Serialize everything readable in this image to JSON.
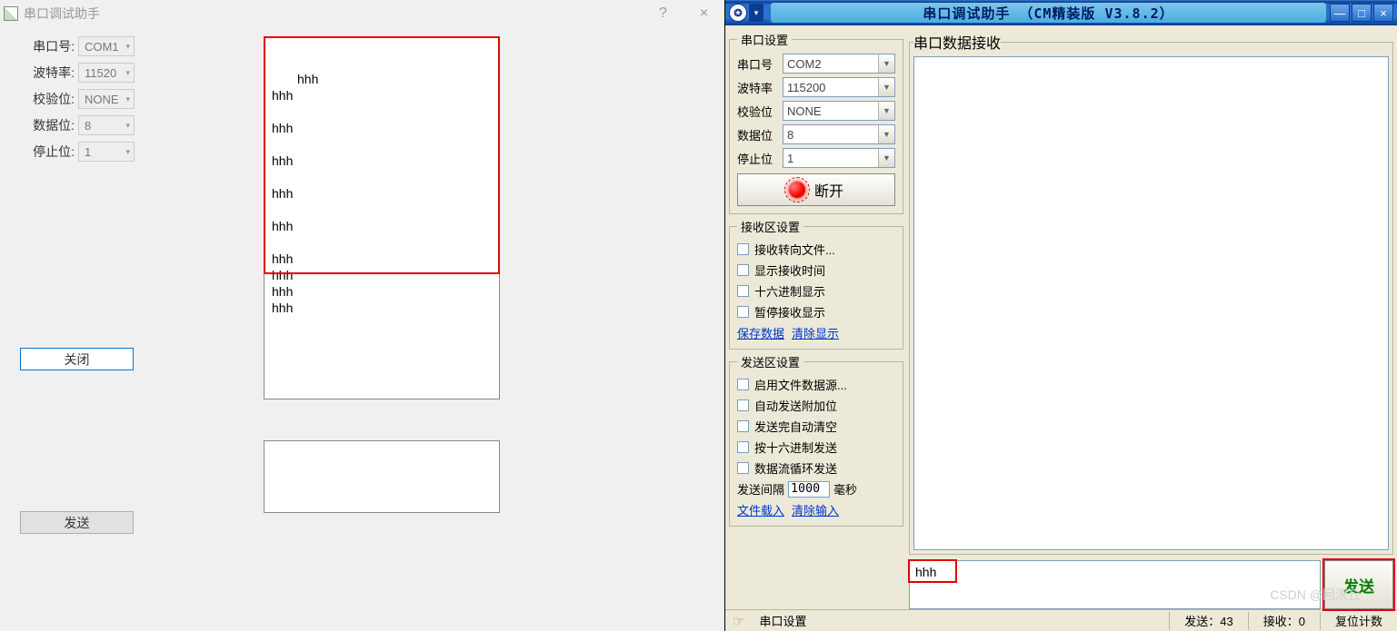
{
  "left": {
    "title": "串口调试助手",
    "help_btn": "?",
    "close_btn": "×",
    "form": {
      "port_label": "串口号:",
      "port_value": "COM1",
      "baud_label": "波特率:",
      "baud_value": "11520",
      "parity_label": "校验位:",
      "parity_value": "NONE",
      "databits_label": "数据位:",
      "databits_value": "8",
      "stopbits_label": "停止位:",
      "stopbits_value": "1"
    },
    "close_button": "关闭",
    "send_button": "发送",
    "rx_text": "hhh\nhhh\n\nhhh\n\nhhh\n\nhhh\n\nhhh\n\nhhh\nhhh\nhhh\nhhh"
  },
  "right": {
    "title": "串口调试助手 （CM精装版 V3.8.2）",
    "cfg": {
      "legend": "串口设置",
      "port_label": "串口号",
      "port_value": "COM2",
      "baud_label": "波特率",
      "baud_value": "115200",
      "parity_label": "校验位",
      "parity_value": "NONE",
      "databits_label": "数据位",
      "databits_value": "8",
      "stopbits_label": "停止位",
      "stopbits_value": "1",
      "disconnect": "断开"
    },
    "rx_settings": {
      "legend": "接收区设置",
      "to_file": "接收转向文件...",
      "show_time": "显示接收时间",
      "hex": "十六进制显示",
      "pause": "暂停接收显示",
      "save": "保存数据",
      "clear": "清除显示"
    },
    "tx_settings": {
      "legend": "发送区设置",
      "file_src": "启用文件数据源...",
      "auto_extra": "自动发送附加位",
      "auto_clear": "发送完自动清空",
      "hex_send": "按十六进制发送",
      "loop_send": "数据流循环发送",
      "interval_label": "发送间隔",
      "interval_value": "1000",
      "interval_unit": "毫秒",
      "file_load": "文件载入",
      "clear_input": "清除输入"
    },
    "rx_legend": "串口数据接收",
    "send_input": "hhh",
    "send_button": "发送",
    "status": {
      "port_cfg": "串口设置",
      "sent": "发送：43",
      "recv": "接收：0",
      "reset": "复位计数"
    }
  },
  "watermark": "CSDN @回溟丘"
}
